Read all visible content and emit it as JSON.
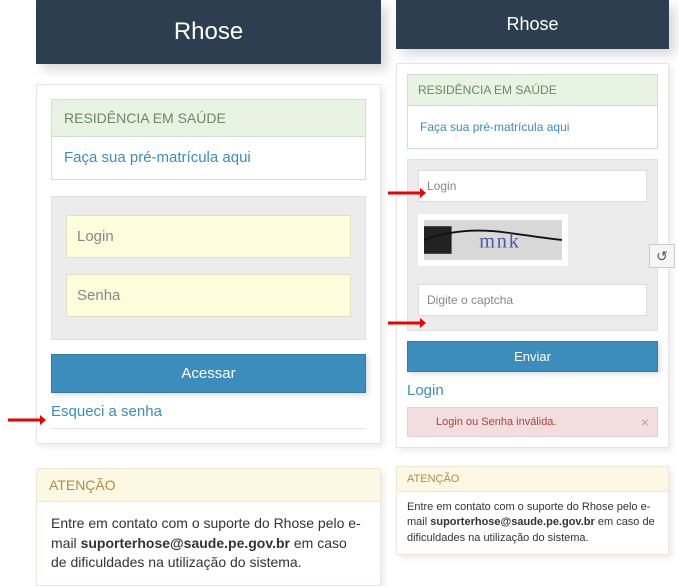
{
  "left": {
    "title": "Rhose",
    "notice": {
      "heading": "RESIDÊNCIA EM SAÚDE",
      "link": "Faça sua pré-matrícula aqui"
    },
    "form": {
      "login_placeholder": "Login",
      "senha_placeholder": "Senha",
      "submit": "Acessar"
    },
    "forgot": "Esqueci a senha",
    "attention": {
      "heading": "ATENÇÃO",
      "text_pre": "Entre em contato com o suporte do Rhose pelo e-mail ",
      "email": "suporterhose@saude.pe.gov.br",
      "text_post": " em caso de dificuldades na utilização do sistema."
    }
  },
  "right": {
    "title": "Rhose",
    "notice": {
      "heading": "RESIDÊNCIA EM SAÚDE",
      "link": "Faça sua pré-matrícula aqui"
    },
    "form": {
      "login_placeholder": "Login",
      "login_value": "",
      "captcha_placeholder": "Digite o captcha",
      "refresh_icon": "↺",
      "submit": "Enviar"
    },
    "login_link": "Login",
    "error": {
      "message": "Login ou Senha inválida.",
      "close": "×"
    },
    "attention": {
      "heading": "ATENÇÃO",
      "text_pre": "Entre em contato com o suporte do Rhose pelo e-mail ",
      "email": "suporterhose@saude.pe.gov.br",
      "text_post": " em caso de dificuldades na utilização do sistema."
    }
  }
}
